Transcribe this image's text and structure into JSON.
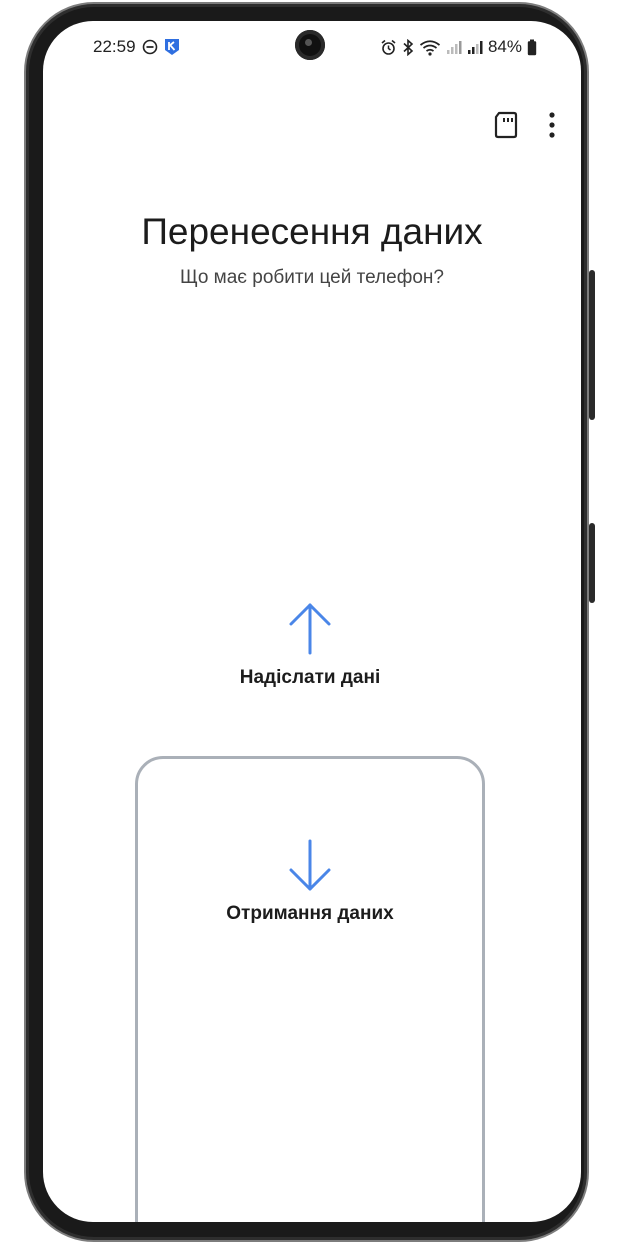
{
  "status_bar": {
    "time": "22:59",
    "battery": "84%",
    "icons_left": [
      "dnd-icon",
      "app-notification-icon"
    ],
    "icons_right": [
      "alarm-icon",
      "bluetooth-icon",
      "wifi-icon",
      "signal-icon",
      "signal-icon",
      "battery-icon"
    ]
  },
  "toolbar": {
    "sd_card_icon": "sd-card-icon",
    "more_icon": "more-options-icon"
  },
  "header": {
    "title": "Перенесення даних",
    "subtitle": "Що має робити цей телефон?"
  },
  "options": {
    "send_label": "Надіслати дані",
    "receive_label": "Отримання даних"
  },
  "colors": {
    "accent": "#4a86e8",
    "card_border": "#aab0b8",
    "text": "#1c1c1c"
  }
}
